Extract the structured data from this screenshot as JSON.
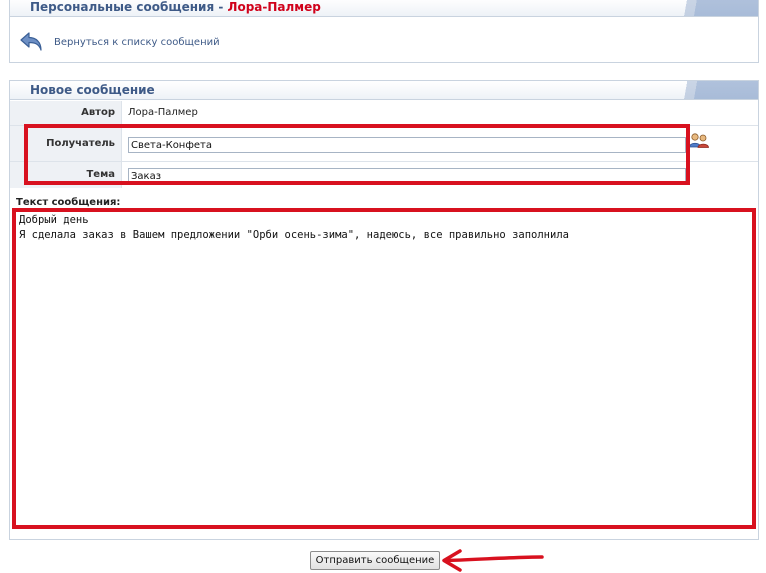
{
  "header": {
    "title_prefix": "Персональные сообщения - ",
    "title_user": "Лора-Палмер",
    "back_link": "Вернуться к списку сообщений"
  },
  "new_message": {
    "panel_title": "Новое сообщение",
    "author_label": "Автор",
    "author_value": "Лора-Палмер",
    "recipient_label": "Получатель",
    "recipient_value": "Света-Конфета",
    "subject_label": "Тема",
    "subject_value": "Заказ",
    "body_label": "Текст сообщения:",
    "body_value": "Добрый день\nЯ сделала заказ в Вашем предложении \"Орби осень-зима\", надеюсь, все правильно заполнила",
    "submit_label": "Отправить сообщение"
  },
  "colors": {
    "title_text": "#3e5a87",
    "title_accent": "#d0021b",
    "annotation": "#d8111f"
  },
  "icons": {
    "back": "back-arrow-icon",
    "contacts": "contacts-icon"
  }
}
